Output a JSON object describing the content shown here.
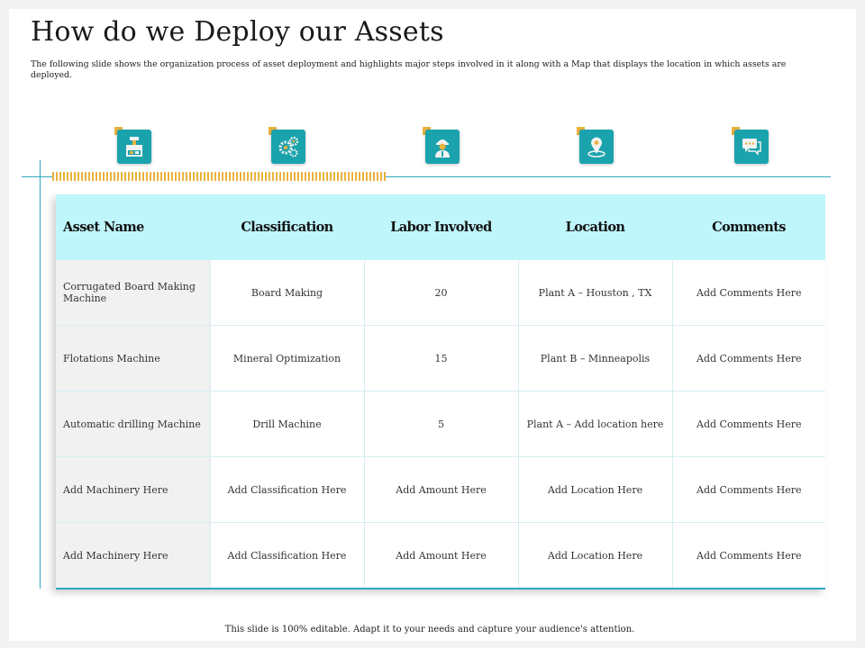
{
  "slide": {
    "title": "How do we Deploy our Assets",
    "subtitle": "The following slide shows the organization process of asset deployment and highlights major steps involved in it along with a Map that displays the location in which assets are deployed.",
    "footer": "This slide is 100% editable. Adapt it to your needs and capture your audience's attention."
  },
  "icons": [
    "machine-icon",
    "gears-icon",
    "worker-icon",
    "location-pin-icon",
    "chat-icon"
  ],
  "colors": {
    "accent": "#1aa3ad",
    "header_fill": "#bff6fb",
    "tag": "#e9b23f",
    "line": "#30a6bf"
  },
  "table": {
    "headers": [
      "Asset Name",
      "Classification",
      "Labor Involved",
      "Location",
      "Comments"
    ],
    "rows": [
      [
        "Corrugated Board Making Machine",
        "Board Making",
        "20",
        "Plant A – Houston , TX",
        "Add Comments Here"
      ],
      [
        "Flotations Machine",
        "Mineral Optimization",
        "15",
        "Plant B – Minneapolis",
        "Add Comments Here"
      ],
      [
        "Automatic drilling Machine",
        "Drill Machine",
        "5",
        "Plant A – Add location here",
        "Add Comments Here"
      ],
      [
        "Add Machinery Here",
        "Add Classification Here",
        "Add Amount Here",
        "Add Location Here",
        "Add Comments Here"
      ],
      [
        "Add Machinery Here",
        "Add Classification Here",
        "Add Amount Here",
        "Add Location Here",
        "Add Comments Here"
      ]
    ]
  }
}
